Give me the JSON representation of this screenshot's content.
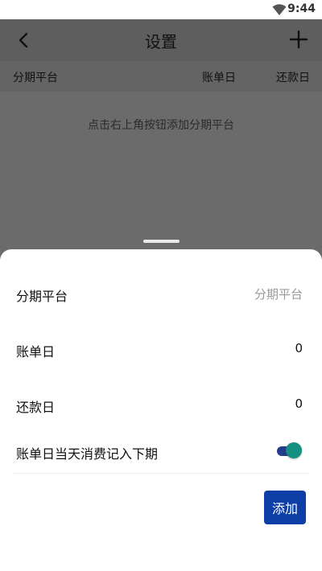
{
  "status_bar": {
    "time": "9:44",
    "wifi_icon": "wifi-icon"
  },
  "app_bar": {
    "title": "设置",
    "back_icon": "back-arrow-icon",
    "add_icon": "plus-icon"
  },
  "table_header": {
    "col_platform": "分期平台",
    "col_bill_day": "账单日",
    "col_repay_day": "还款日"
  },
  "empty_hint": "点击右上角按钮添加分期平台",
  "sheet": {
    "platform_label": "分期平台",
    "platform_placeholder": "分期平台",
    "bill_day_label": "账单日",
    "bill_day_value": "0",
    "repay_day_label": "还款日",
    "repay_day_value": "0",
    "next_period_label": "账单日当天消费记入下期",
    "next_period_toggle_on": true,
    "add_button_label": "添加"
  },
  "colors": {
    "accent": "#0d3ea6",
    "toggle_thumb": "#149081",
    "toggle_track": "#243c8c"
  }
}
